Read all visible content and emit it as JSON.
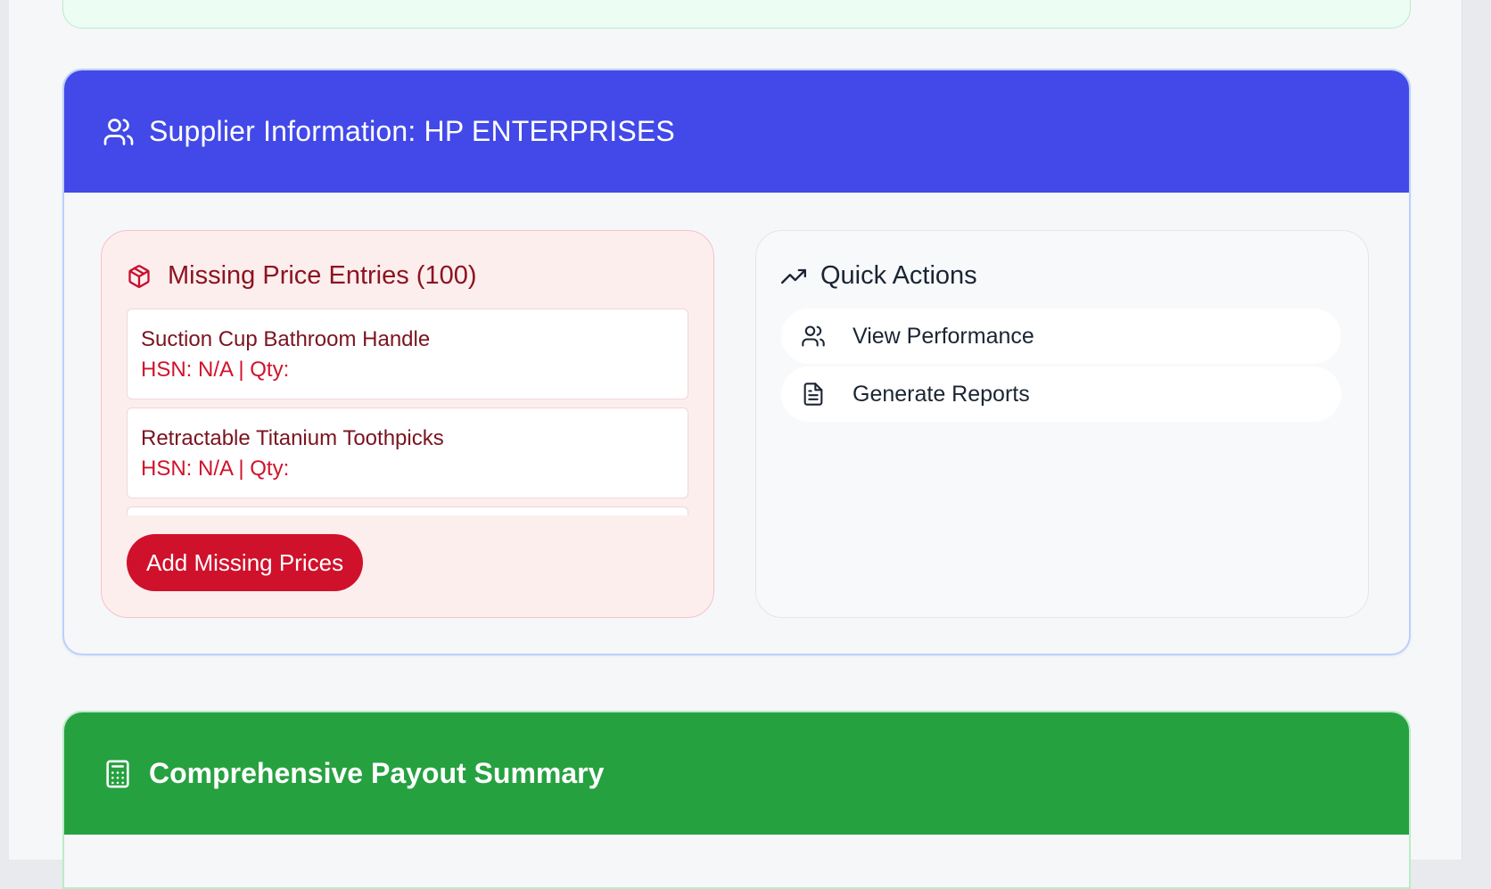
{
  "supplier_section": {
    "title": "Supplier Information: HP ENTERPRISES",
    "header_color": "#4249e8",
    "header_icon": "users-icon"
  },
  "missing_prices": {
    "heading": "Missing Price Entries (100)",
    "heading_icon": "package-icon",
    "items": [
      {
        "name": "Suction Cup Bathroom Handle",
        "meta": "HSN: N/A | Qty:"
      },
      {
        "name": "Retractable Titanium Toothpicks",
        "meta": "HSN: N/A | Qty:"
      }
    ],
    "button_label": "Add Missing Prices",
    "accent_color": "#d0112b"
  },
  "quick_actions": {
    "heading": "Quick Actions",
    "heading_icon": "trending-up-icon",
    "items": [
      {
        "label": "View Performance",
        "icon": "users-icon"
      },
      {
        "label": "Generate Reports",
        "icon": "file-text-icon"
      }
    ]
  },
  "payout_section": {
    "title": "Comprehensive Payout Summary",
    "header_color": "#26a140",
    "header_icon": "calculator-icon"
  }
}
